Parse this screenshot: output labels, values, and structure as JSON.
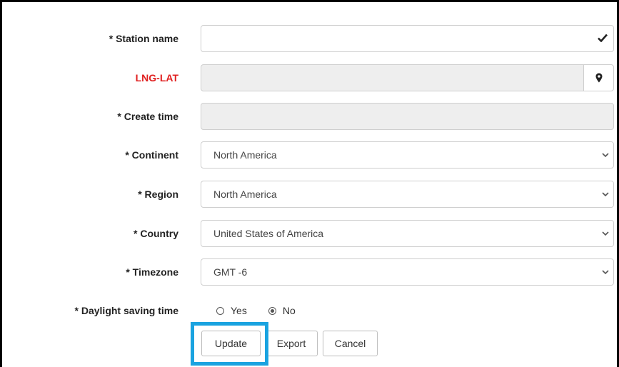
{
  "form": {
    "station_name": {
      "label": "* Station name",
      "value": ""
    },
    "lng_lat": {
      "label": "LNG-LAT",
      "value": ""
    },
    "create_time": {
      "label": "* Create time",
      "value": ""
    },
    "continent": {
      "label": "* Continent",
      "value": "North America"
    },
    "region": {
      "label": "* Region",
      "value": "North America"
    },
    "country": {
      "label": "* Country",
      "value": "United States of America"
    },
    "timezone": {
      "label": "* Timezone",
      "value": "GMT -6"
    },
    "daylight_saving": {
      "label": "* Daylight saving time",
      "options": [
        "Yes",
        "No"
      ],
      "selected": "No"
    }
  },
  "buttons": {
    "update": "Update",
    "export": "Export",
    "cancel": "Cancel"
  },
  "colors": {
    "required_red": "#e02020",
    "highlight": "#1aa3e0"
  },
  "icons": {
    "validated": "check-icon",
    "locate": "map-marker-icon",
    "dropdown": "chevron-down-icon"
  }
}
